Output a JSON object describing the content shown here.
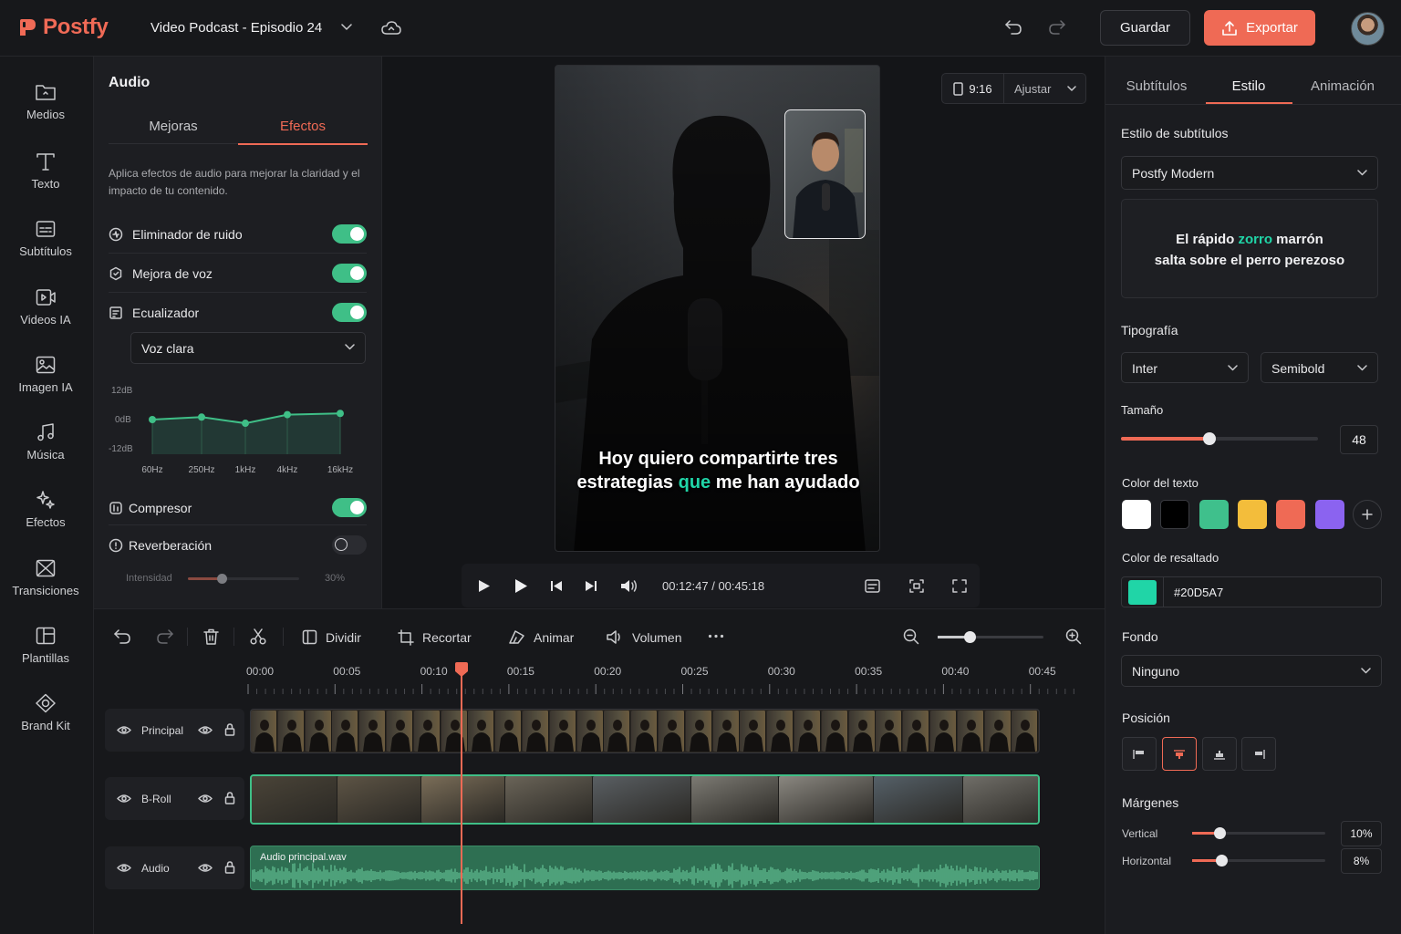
{
  "app": {
    "name": "Postfy"
  },
  "header": {
    "project_title": "Video Podcast - Episodio 24",
    "save_label": "Guardar",
    "export_label": "Exportar"
  },
  "rail": {
    "items": [
      {
        "label": "Medios",
        "icon": "folder-icon"
      },
      {
        "label": "Texto",
        "icon": "text-icon"
      },
      {
        "label": "Subtítulos",
        "icon": "subtitles-icon"
      },
      {
        "label": "Videos IA",
        "icon": "ai-video-icon"
      },
      {
        "label": "Imagen IA",
        "icon": "image-icon"
      },
      {
        "label": "Música",
        "icon": "music-icon"
      },
      {
        "label": "Efectos",
        "icon": "sparkle-icon"
      },
      {
        "label": "Transiciones",
        "icon": "transition-icon"
      },
      {
        "label": "Plantillas",
        "icon": "template-icon"
      },
      {
        "label": "Brand Kit",
        "icon": "brand-icon"
      }
    ]
  },
  "audio_panel": {
    "title": "Audio",
    "tabs": [
      {
        "label": "Mejoras",
        "active": false
      },
      {
        "label": "Efectos",
        "active": true
      }
    ],
    "description": "Aplica efectos de audio para mejorar la claridad y el impacto de tu contenido.",
    "effects": [
      {
        "label": "Eliminador de ruido",
        "enabled": true
      },
      {
        "label": "Mejora de voz",
        "enabled": true
      },
      {
        "label": "Ecualizador",
        "enabled": true
      }
    ],
    "eq_preset": "Voz clara",
    "eq": {
      "y_labels": [
        "12dB",
        "0dB",
        "-12dB"
      ],
      "bands": [
        "60Hz",
        "250Hz",
        "1kHz",
        "4kHz",
        "16kHz"
      ],
      "values_db": [
        0,
        1,
        -1.5,
        2,
        2.5
      ]
    },
    "compressor": {
      "label": "Compresor",
      "enabled": true
    },
    "reverb": {
      "label": "Reverberación",
      "enabled": false
    },
    "intensity": {
      "label": "Intensidad",
      "value_text": "30%",
      "value": 0.3
    }
  },
  "preview": {
    "ratio": "9:16",
    "fit": "Ajustar",
    "subtitle": {
      "line1": "Hoy quiero compartirte tres",
      "line2_pre": "estrategias ",
      "line2_hl": "que",
      "line2_post": " me han ayudado"
    },
    "time_current": "00:12:47",
    "time_separator": " / ",
    "time_total": "00:45:18"
  },
  "right_panel": {
    "tabs": [
      {
        "label": "Subtítulos",
        "active": false
      },
      {
        "label": "Estilo",
        "active": true
      },
      {
        "label": "Animación",
        "active": false
      }
    ],
    "style_label": "Estilo de subtítulos",
    "style_value": "Postfy Modern",
    "sample": {
      "pre": "El rápido ",
      "hl": "zorro",
      "post": " marrón",
      "line2": "salta sobre el perro perezoso"
    },
    "typography_label": "Tipografía",
    "font_value": "Inter",
    "weight_value": "Semibold",
    "size_label": "Tamaño",
    "size_value": "48",
    "size_fraction": 0.45,
    "text_color_label": "Color del texto",
    "text_colors": [
      "#ffffff",
      "#000000",
      "#3fc08c",
      "#f3bd3b",
      "#ef6a55",
      "#8b63f0"
    ],
    "highlight_label": "Color de resaltado",
    "highlight_hex": "#20D5A7",
    "background_label": "Fondo",
    "background_value": "Ninguno",
    "position_label": "Posición",
    "margins_label": "Márgenes",
    "vertical_label": "Vertical",
    "vertical_value": "10%",
    "horizontal_label": "Horizontal",
    "horizontal_value": "8%"
  },
  "timeline": {
    "tools": {
      "split": "Dividir",
      "crop": "Recortar",
      "animate": "Animar",
      "volume": "Volumen"
    },
    "ruler": [
      "00:00",
      "00:05",
      "00:10",
      "00:15",
      "00:20",
      "00:25",
      "00:30",
      "00:35",
      "00:40",
      "00:45"
    ],
    "tracks": [
      {
        "name": "Principal"
      },
      {
        "name": "B-Roll"
      },
      {
        "name": "Audio"
      }
    ],
    "audio_clip_name": "Audio principal.wav",
    "colors": {
      "accent": "#ef6a55",
      "green": "#3fbf87"
    }
  }
}
